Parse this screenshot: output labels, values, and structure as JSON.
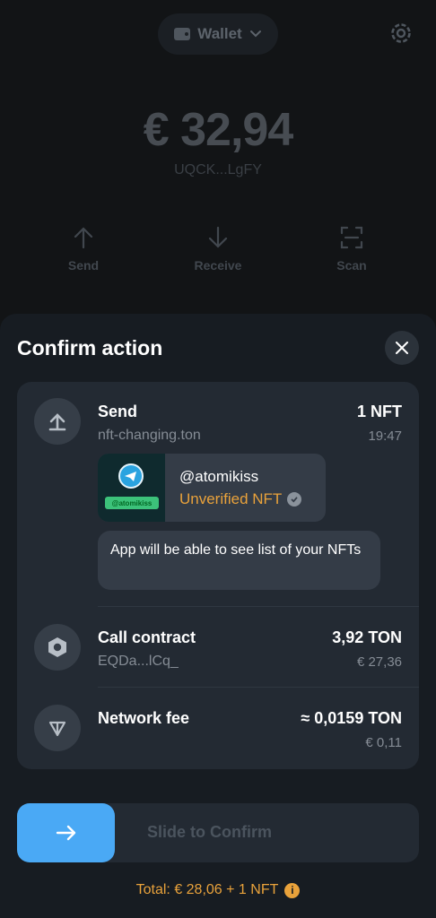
{
  "background": {
    "wallet_selector": "Wallet",
    "balance": "€ 32,94",
    "address": "UQCK...LgFY",
    "actions": [
      {
        "label": "Send",
        "icon": "arrow-up-icon"
      },
      {
        "label": "Receive",
        "icon": "arrow-down-icon"
      },
      {
        "label": "Scan",
        "icon": "scan-icon"
      }
    ]
  },
  "sheet": {
    "title": "Confirm action",
    "send": {
      "label": "Send",
      "destination": "nft-changing.ton",
      "amount": "1 NFT",
      "time": "19:47",
      "nft": {
        "name": "@atomikiss",
        "status": "Unverified NFT",
        "tag": "@atomikiss"
      },
      "notice": "App will be able to see list of your NFTs"
    },
    "call_contract": {
      "label": "Call contract",
      "address": "EQDa...lCq_",
      "amount": "3,92 TON",
      "fiat": "€ 27,36"
    },
    "network_fee": {
      "label": "Network fee",
      "amount": "≈ 0,0159 TON",
      "fiat": "€ 0,11"
    },
    "slider_label": "Slide to Confirm",
    "total": "Total: € 28,06 + 1 NFT"
  },
  "colors": {
    "accent": "#4aa9f5",
    "warning": "#e9a23b",
    "card": "#232a33"
  }
}
